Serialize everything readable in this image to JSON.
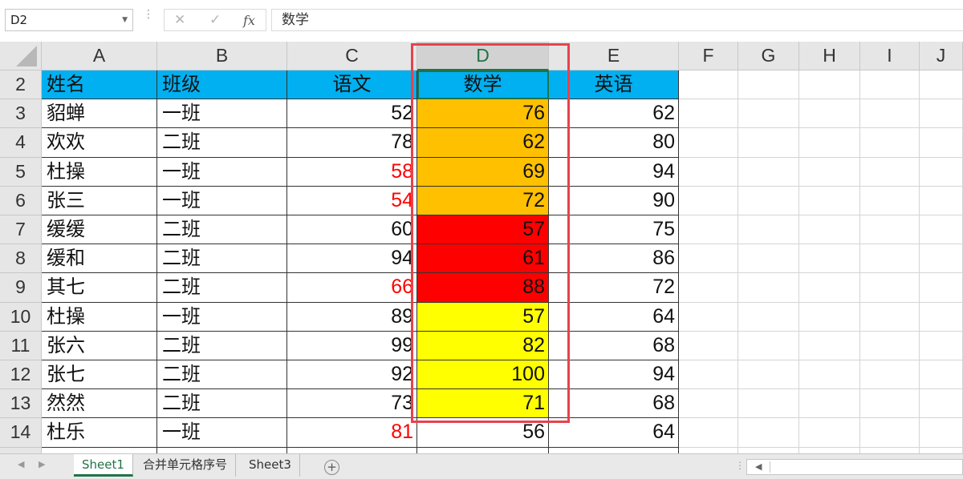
{
  "formula_bar": {
    "name_box": "D2",
    "cancel_icon": "✕",
    "enter_icon": "✓",
    "fx_label": "fx",
    "formula": "数学"
  },
  "columns": [
    "A",
    "B",
    "C",
    "D",
    "E",
    "F",
    "G",
    "H",
    "I",
    "J"
  ],
  "selected_column": "D",
  "rows": [
    {
      "row": "2",
      "name": "姓名",
      "class": "班级",
      "chinese": "语文",
      "math": "数学",
      "english": "英语",
      "header": true
    },
    {
      "row": "3",
      "name": "貂蝉",
      "class": "一班",
      "chinese": "52",
      "math": "76",
      "english": "62"
    },
    {
      "row": "4",
      "name": "欢欢",
      "class": "二班",
      "chinese": "78",
      "math": "62",
      "english": "80"
    },
    {
      "row": "5",
      "name": "杜操",
      "class": "一班",
      "chinese": "58",
      "math": "69",
      "english": "94"
    },
    {
      "row": "6",
      "name": "张三",
      "class": "一班",
      "chinese": "54",
      "math": "72",
      "english": "90"
    },
    {
      "row": "7",
      "name": "缓缓",
      "class": "二班",
      "chinese": "60",
      "math": "57",
      "english": "75"
    },
    {
      "row": "8",
      "name": "缓和",
      "class": "二班",
      "chinese": "94",
      "math": "61",
      "english": "86"
    },
    {
      "row": "9",
      "name": "其七",
      "class": "二班",
      "chinese": "66",
      "math": "88",
      "english": "72"
    },
    {
      "row": "10",
      "name": "杜操",
      "class": "一班",
      "chinese": "89",
      "math": "57",
      "english": "64"
    },
    {
      "row": "11",
      "name": "张六",
      "class": "二班",
      "chinese": "99",
      "math": "82",
      "english": "68"
    },
    {
      "row": "12",
      "name": "张七",
      "class": "二班",
      "chinese": "92",
      "math": "100",
      "english": "94"
    },
    {
      "row": "13",
      "name": "然然",
      "class": "二班",
      "chinese": "73",
      "math": "71",
      "english": "68"
    },
    {
      "row": "14",
      "name": "杜乐",
      "class": "一班",
      "chinese": "81",
      "math": "56",
      "english": "64"
    }
  ],
  "colors": {
    "header_fill": "#00b0f0",
    "orange_fill": "#ffc000",
    "red_fill": "#ff0000",
    "yellow_fill": "#ffff00",
    "red_text": "#ff0000",
    "accent": "#217346",
    "highlight_box": "#e8424a"
  },
  "red_chinese_rows": [
    "5",
    "6",
    "9",
    "14"
  ],
  "math_fill_by_row": {
    "3": "orange",
    "4": "orange",
    "5": "orange",
    "6": "orange",
    "7": "red",
    "8": "red",
    "9": "red",
    "10": "yellow",
    "11": "yellow",
    "12": "yellow",
    "13": "yellow"
  },
  "sheet_tabs": [
    "Sheet1",
    "合并单元格序号",
    "Sheet3"
  ],
  "active_tab": "Sheet1",
  "add_sheet_icon": "+"
}
